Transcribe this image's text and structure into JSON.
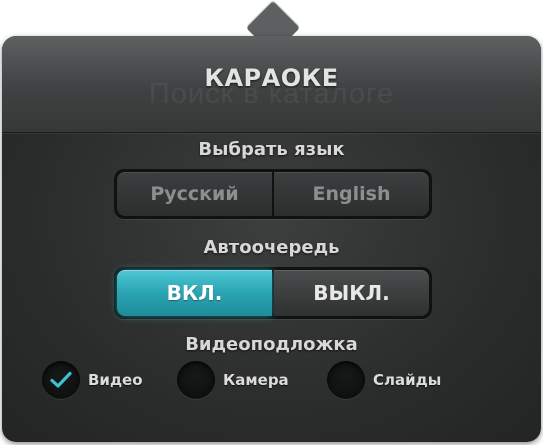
{
  "popover": {
    "background_text": "Поиск в каталоге",
    "title": "КАРАОКЕ"
  },
  "language": {
    "label": "Выбрать язык",
    "options": [
      "Русский",
      "English"
    ]
  },
  "autoqueue": {
    "label": "Автоочередь",
    "on_label": "ВКЛ.",
    "off_label": "ВЫКЛ.",
    "selected": "ВКЛ."
  },
  "background": {
    "label": "Видеоподложка",
    "options": [
      {
        "label": "Видео",
        "checked": true
      },
      {
        "label": "Камера",
        "checked": false
      },
      {
        "label": "Слайды",
        "checked": false
      }
    ]
  },
  "colors": {
    "accent": "#2aa4b3",
    "panel": "#2b2d2d",
    "check": "#3bc3d2"
  },
  "icons": {
    "checkmark": "check-icon"
  }
}
